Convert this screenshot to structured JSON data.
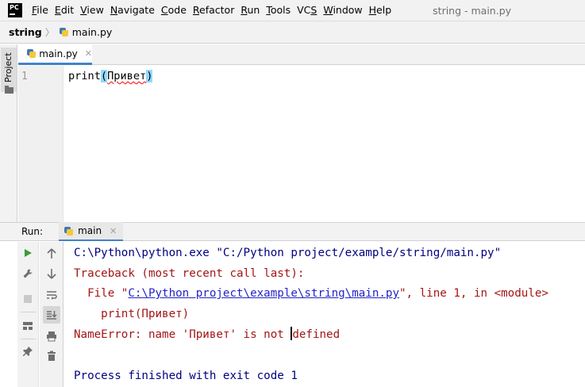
{
  "app": {
    "logo_text": "PC",
    "window_title": "string - main.py"
  },
  "menu": [
    {
      "prefix": "",
      "mnemonic": "F",
      "rest": "ile"
    },
    {
      "prefix": "",
      "mnemonic": "E",
      "rest": "dit"
    },
    {
      "prefix": "",
      "mnemonic": "V",
      "rest": "iew"
    },
    {
      "prefix": "",
      "mnemonic": "N",
      "rest": "avigate"
    },
    {
      "prefix": "",
      "mnemonic": "C",
      "rest": "ode"
    },
    {
      "prefix": "",
      "mnemonic": "R",
      "rest": "efactor"
    },
    {
      "prefix": "",
      "mnemonic": "R",
      "rest": "un"
    },
    {
      "prefix": "",
      "mnemonic": "T",
      "rest": "ools"
    },
    {
      "prefix": "VC",
      "mnemonic": "S",
      "rest": ""
    },
    {
      "prefix": "",
      "mnemonic": "W",
      "rest": "indow"
    },
    {
      "prefix": "",
      "mnemonic": "H",
      "rest": "elp"
    }
  ],
  "breadcrumb": {
    "project": "string",
    "file": "main.py"
  },
  "left_strip": {
    "project_label": "Project"
  },
  "editor": {
    "tab_label": "main.py",
    "line_number": "1",
    "code": {
      "func": "print",
      "open": "(",
      "arg": "Привет",
      "close": ")"
    }
  },
  "run": {
    "label": "Run:",
    "tab_label": "main",
    "console": {
      "cmd_line": "C:\\Python\\python.exe \"C:/Python project/example/string/main.py\"",
      "traceback": "Traceback (most recent call last):",
      "file_prefix": "  File \"",
      "file_link": "C:\\Python project\\example\\string\\main.py",
      "file_suffix": "\", line 1, in <module>",
      "code_line": "    print(Привет)",
      "error_before_caret": "NameError: name 'Привет' is not ",
      "error_after_caret": "defined",
      "exit": "Process finished with exit code 1"
    }
  },
  "colors": {
    "accent": "#4083c9",
    "run_green": "#3a9c3a",
    "error": "#a31515",
    "link": "#2323c8",
    "console_text": "#000080"
  },
  "icons": [
    "pycharm-logo-icon",
    "python-file-icon",
    "folder-icon",
    "run-icon",
    "wrench-icon",
    "stop-icon",
    "layout-icon",
    "pin-icon",
    "scroll-up-icon",
    "scroll-down-icon",
    "soft-wrap-icon",
    "scroll-to-end-icon",
    "print-icon",
    "trash-icon",
    "close-icon"
  ]
}
